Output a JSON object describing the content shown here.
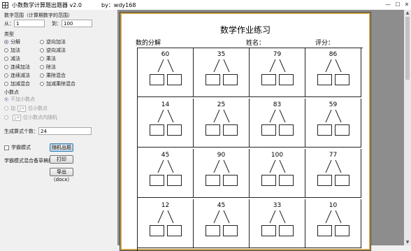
{
  "window": {
    "title": "小数数学计算题出题器 v2.0",
    "author": "by：wdy168"
  },
  "panel": {
    "range_title": "数字范围（计算期数字的范围）",
    "from_label": "从：",
    "from_value": "1",
    "to_label": "到：",
    "to_value": "100",
    "type_title": "类型",
    "types": [
      {
        "label": "分解",
        "selected": true
      },
      {
        "label": "逆向加法",
        "selected": false
      },
      {
        "label": "加法",
        "selected": false
      },
      {
        "label": "逆向减法",
        "selected": false
      },
      {
        "label": "减法",
        "selected": false
      },
      {
        "label": "乘法",
        "selected": false
      },
      {
        "label": "连续加法",
        "selected": false
      },
      {
        "label": "除法",
        "selected": false
      },
      {
        "label": "连续减法",
        "selected": false
      },
      {
        "label": "乘除混合",
        "selected": false
      },
      {
        "label": "加减混合",
        "selected": false
      },
      {
        "label": "加减乘除混合",
        "selected": false
      }
    ],
    "decimal_title": "小数点",
    "decimal_none": "不加小数点",
    "decimal_add": "加",
    "decimal_add_value": "2",
    "decimal_add_suffix": "位小数点",
    "decimal_rand_value": "2",
    "decimal_rand_suffix": "位小数点内随机",
    "count_label": "生成算式个数：",
    "count_value": "24",
    "study_mode": "学霸模式",
    "random_btn": "随机出题",
    "study_note": "学霸模式混合备草稿纸",
    "print_btn": "打印",
    "export_btn": "导出（docx）"
  },
  "sheet": {
    "title": "数学作业练习",
    "subject": "数的分解",
    "name_label": "姓名：",
    "score_label": "评分：",
    "numbers": [
      "60",
      "35",
      "79",
      "86",
      "14",
      "25",
      "83",
      "59",
      "45",
      "90",
      "100",
      "77",
      "12",
      "45",
      "33",
      "10"
    ]
  }
}
